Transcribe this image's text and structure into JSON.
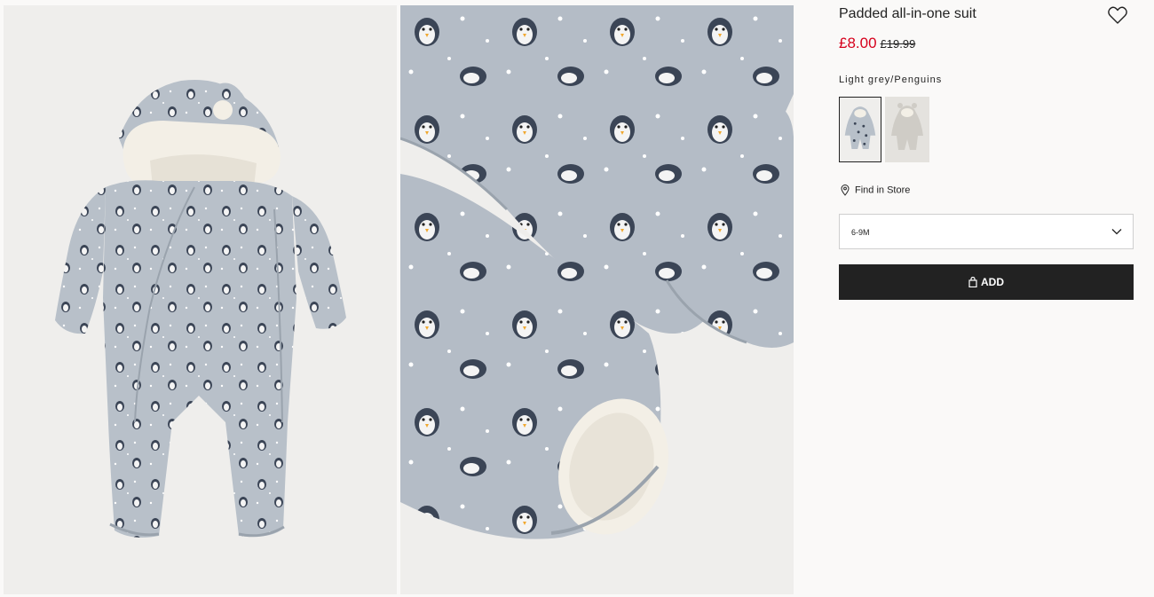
{
  "product": {
    "title": "Padded all-in-one suit",
    "price_sale": "£8.00",
    "price_original": "£19.99",
    "color_name": "Light grey/Penguins",
    "find_in_store": "Find in Store",
    "selected_size": "6-9M",
    "add_button_label": "ADD"
  },
  "colors": {
    "sale_red": "#d6001c",
    "button_bg": "#222222",
    "suit_grey": "#b8c0c9",
    "penguin_navy": "#3b4556",
    "fur_white": "#f3efe6"
  },
  "icons": {
    "favorite": "heart-icon",
    "location": "map-pin-icon",
    "dropdown": "chevron-down-icon",
    "bag": "shopping-bag-icon"
  }
}
